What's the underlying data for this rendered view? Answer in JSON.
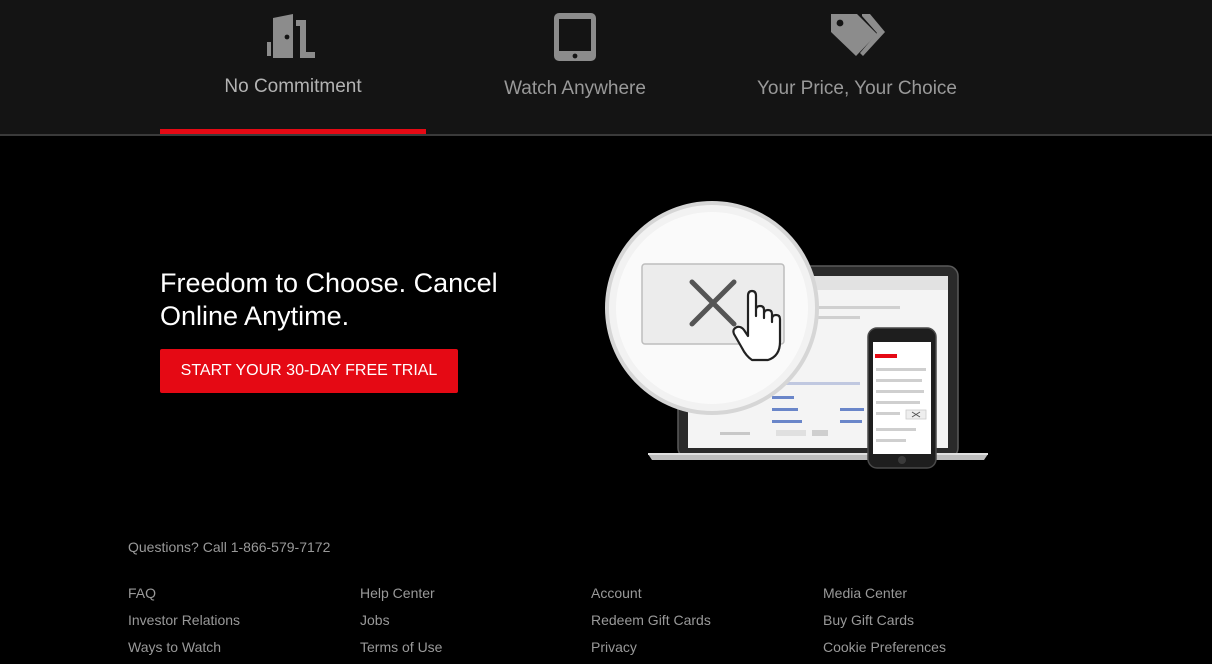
{
  "tabs": [
    {
      "label": "No Commitment",
      "icon": "door-icon",
      "active": true
    },
    {
      "label": "Watch Anywhere",
      "icon": "tablet-icon",
      "active": false
    },
    {
      "label": "Your Price, Your Choice",
      "icon": "price-tags-icon",
      "active": false
    }
  ],
  "hero": {
    "headline": "Freedom to Choose. Cancel Online Anytime.",
    "cta_label": "START YOUR 30-DAY FREE TRIAL"
  },
  "footer": {
    "phone_text": "Questions? Call 1-866-579-7172",
    "columns": [
      [
        "FAQ",
        "Investor Relations",
        "Ways to Watch"
      ],
      [
        "Help Center",
        "Jobs",
        "Terms of Use"
      ],
      [
        "Account",
        "Redeem Gift Cards",
        "Privacy"
      ],
      [
        "Media Center",
        "Buy Gift Cards",
        "Cookie Preferences"
      ]
    ]
  },
  "colors": {
    "accent": "#e50914",
    "tab_bg": "#141414",
    "page_bg": "#000000",
    "muted_text": "#999999"
  }
}
